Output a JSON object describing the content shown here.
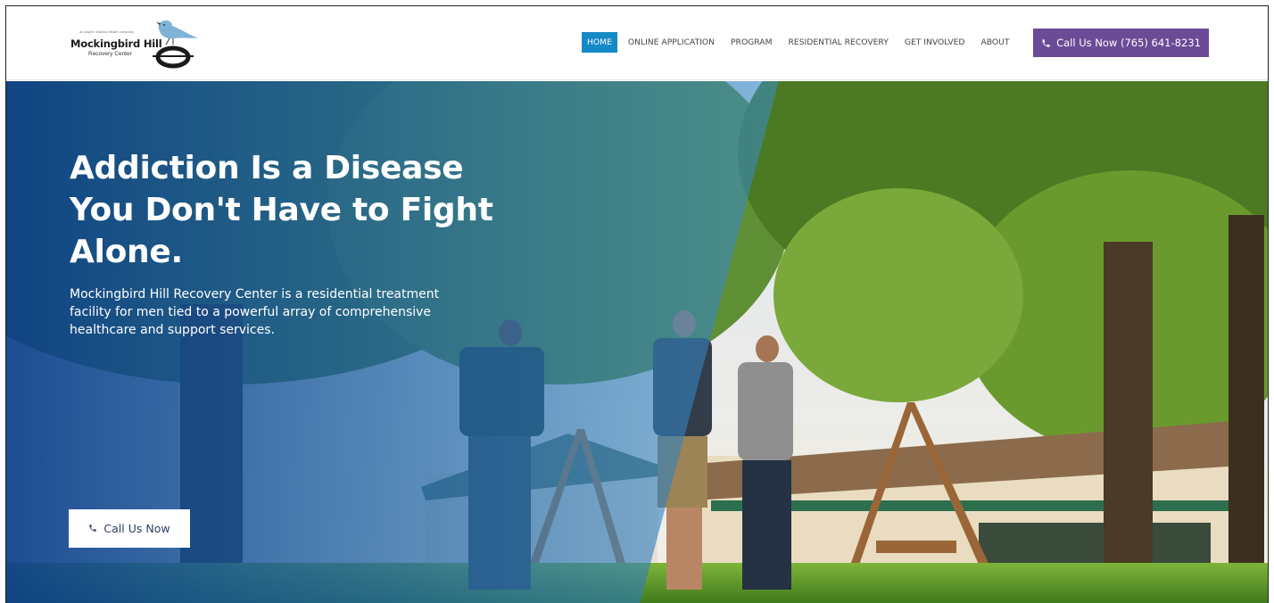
{
  "header": {
    "logo": {
      "tagline": "an Aspire Indiana Health company",
      "name": "Mockingbird Hill",
      "subname": "Recovery Center",
      "icon": "mockingbird-logo-icon"
    },
    "nav": [
      {
        "label": "HOME",
        "active": true
      },
      {
        "label": "ONLINE APPLICATION",
        "active": false
      },
      {
        "label": "PROGRAM",
        "active": false
      },
      {
        "label": "RESIDENTIAL RECOVERY",
        "active": false
      },
      {
        "label": "GET INVOLVED",
        "active": false
      },
      {
        "label": "ABOUT",
        "active": false
      }
    ],
    "cta_label": "Call Us Now (765) 641-8231",
    "cta_icon": "phone-icon"
  },
  "hero": {
    "title_lines": [
      "Addiction Is a Disease",
      "You Don't Have to Fight",
      "Alone."
    ],
    "description": "Mockingbird Hill Recovery Center is a residential treatment facility for men tied to a powerful array of comprehensive healthcare and support services.",
    "button_label": "Call Us Now",
    "button_icon": "phone-icon"
  },
  "colors": {
    "nav_active": "#1689c7",
    "cta": "#6b4a96",
    "hero_overlay": "#0b3f8a",
    "logo_bird": "#7fb3d5"
  }
}
